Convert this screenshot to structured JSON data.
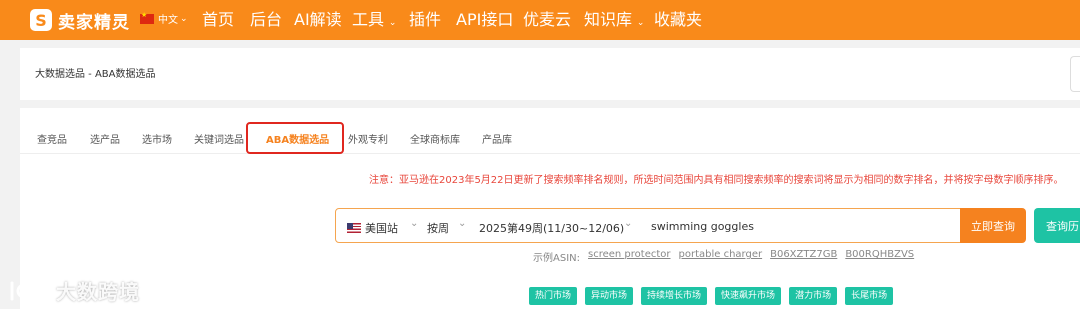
{
  "brand": {
    "name": "卖家精灵",
    "mark": "S"
  },
  "lang": {
    "label": "中文"
  },
  "nav": [
    {
      "label": "首页",
      "dropdown": false
    },
    {
      "label": "后台",
      "dropdown": false
    },
    {
      "label": "AI解读",
      "dropdown": false
    },
    {
      "label": "工具",
      "dropdown": true
    },
    {
      "label": "插件",
      "dropdown": false
    },
    {
      "label": "API接口",
      "dropdown": false
    },
    {
      "label": "优麦云",
      "dropdown": false
    },
    {
      "label": "知识库",
      "dropdown": true
    },
    {
      "label": "收藏夹",
      "dropdown": false
    }
  ],
  "breadcrumb": "大数据选品 - ABA数据选品",
  "tabs": [
    {
      "label": "查竞品"
    },
    {
      "label": "选产品"
    },
    {
      "label": "选市场"
    },
    {
      "label": "关键词选品"
    },
    {
      "label": "ABA数据选品",
      "active": true
    },
    {
      "label": "外观专利"
    },
    {
      "label": "全球商标库"
    },
    {
      "label": "产品库"
    }
  ],
  "notice": "注意：亚马逊在2023年5月22日更新了搜索频率排名规则，所选时间范围内具有相同搜索频率的搜索词将显示为相同的数字排名，并将按字母数字顺序排序。",
  "search": {
    "site": "美国站",
    "period": "按周",
    "week": "2025第49周(11/30~12/06)",
    "keyword": "swimming goggles",
    "query_button": "立即查询",
    "history_button": "查询历"
  },
  "asin_examples": {
    "label": "示例ASIN:",
    "items": [
      "screen protector",
      "portable charger",
      "B06XZTZ7GB",
      "B00RQHBZVS"
    ]
  },
  "markets": [
    "热门市场",
    "异动市场",
    "持续增长市场",
    "快速飙升市场",
    "潜力市场",
    "长尾市场"
  ],
  "watermark": "大数跨境",
  "colors": {
    "brand_orange": "#f98a1a",
    "accent_green": "#1ec3a4",
    "notice_red": "#e8473c",
    "highlight_box": "#e0271f"
  }
}
